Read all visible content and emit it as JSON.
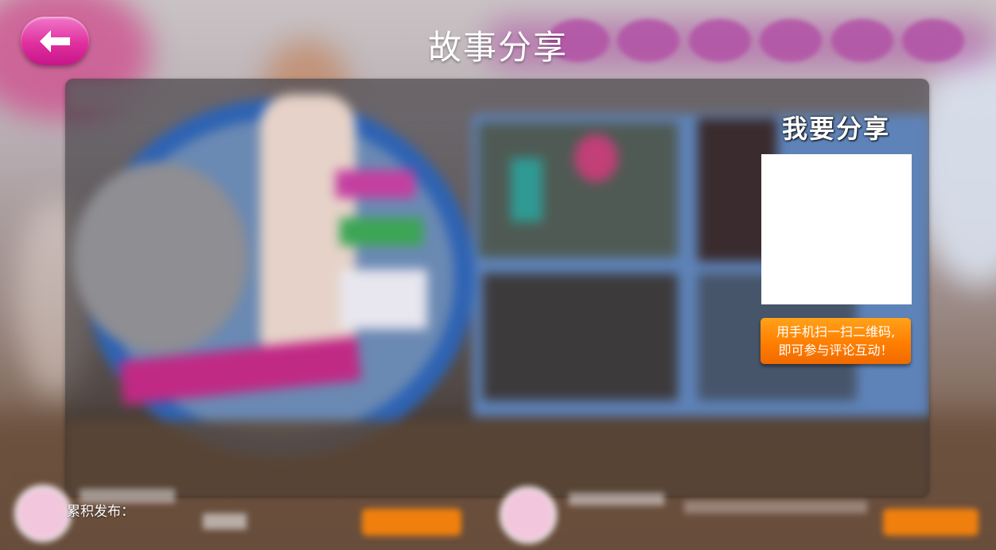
{
  "header": {
    "title": "故事分享",
    "back_icon": "arrow-left-icon"
  },
  "share_panel": {
    "title": "我要分享",
    "qr_code": "qr-code-placeholder",
    "scan_hint_line1": "用手机扫一扫二维码,",
    "scan_hint_line2": "即可参与评论互动！"
  },
  "footer": {
    "cumulative_label": "累积发布："
  },
  "colors": {
    "back_button": "#e0309e",
    "scan_button": "#ff7e00",
    "title_text": "#ffffff"
  }
}
